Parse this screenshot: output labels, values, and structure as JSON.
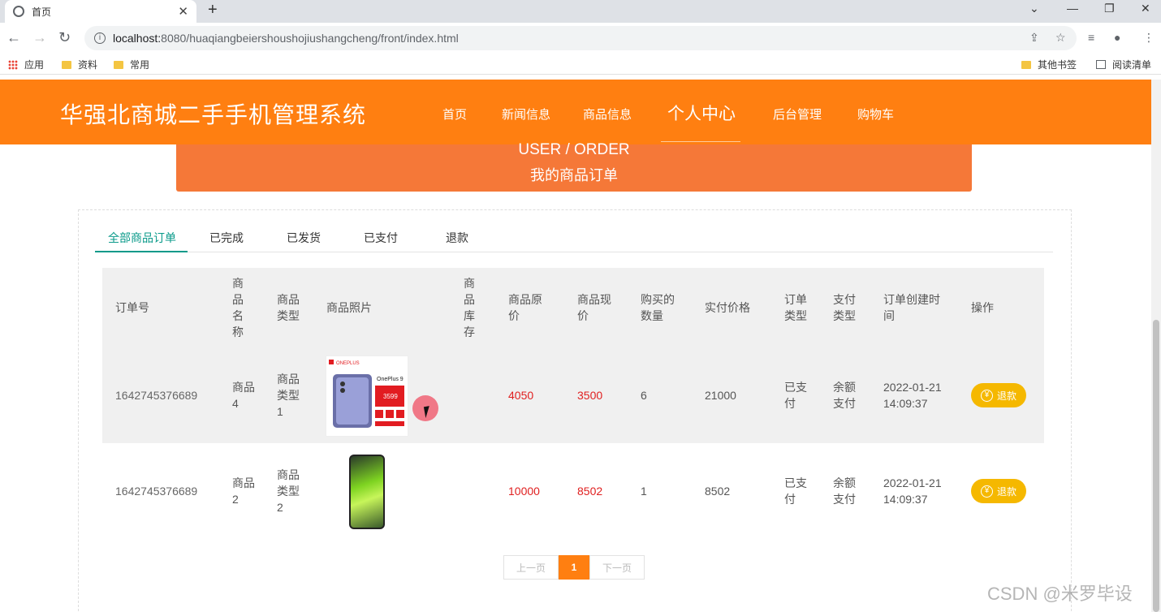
{
  "browser": {
    "tab_title": "首页",
    "url_host": "localhost:",
    "url_rest": "8080/huaqiangbeiershoushojiushangcheng/front/index.html",
    "bookmarks": [
      "应用",
      "资料",
      "常用"
    ],
    "bookmarks_right": [
      "其他书签",
      "阅读清单"
    ]
  },
  "site": {
    "title": "华强北商城二手手机管理系统",
    "nav": [
      "首页",
      "新闻信息",
      "商品信息",
      "个人中心",
      "后台管理",
      "购物车"
    ]
  },
  "banner": {
    "en": "USER / ORDER",
    "cn": "我的商品订单"
  },
  "filter_tabs": [
    "全部商品订单",
    "已完成",
    "已发货",
    "已支付",
    "退款"
  ],
  "table": {
    "headers": {
      "order_no": "订单号",
      "name": "商品名称",
      "type": "商品类型",
      "photo": "商品照片",
      "stock": "商品库存",
      "orig_price": "商品原价",
      "cur_price": "商品现价",
      "qty": "购买的数量",
      "paid": "实付价格",
      "order_type": "订单类型",
      "pay_type": "支付类型",
      "created": "订单创建时间",
      "action": "操作"
    },
    "rows": [
      {
        "order_no": "1642745376689",
        "name": "商品4",
        "type": "商品类型1",
        "stock": "",
        "orig_price": "4050",
        "cur_price": "3500",
        "qty": "6",
        "paid": "21000",
        "order_type": "已支付",
        "pay_type": "余额支付",
        "created_date": "2022-01-21",
        "created_time": "14:09:37",
        "action": "退款"
      },
      {
        "order_no": "1642745376689",
        "name": "商品2",
        "type": "商品类型2",
        "stock": "",
        "orig_price": "10000",
        "cur_price": "8502",
        "qty": "1",
        "paid": "8502",
        "order_type": "已支付",
        "pay_type": "余额支付",
        "created_date": "2022-01-21",
        "created_time": "14:09:37",
        "action": "退款"
      }
    ]
  },
  "product_image_1": {
    "brand": "ONEPLUS",
    "model": "OnePlus 9",
    "price": "3599"
  },
  "pager": {
    "prev": "上一页",
    "current": "1",
    "next": "下一页"
  },
  "watermark": "CSDN @米罗毕设",
  "colors": {
    "header": "#ff7f11",
    "banner": "#f57838",
    "active_tab": "#0a9a8a",
    "price": "#e02020",
    "refund_button": "#f5b800"
  }
}
